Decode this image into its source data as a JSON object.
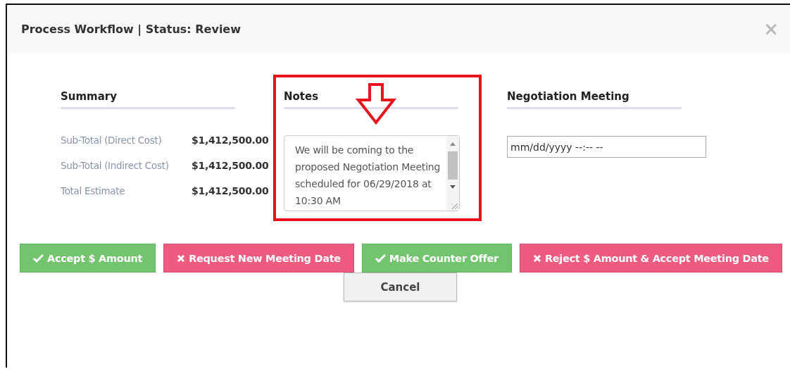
{
  "dialog": {
    "title": "Process Workflow | Status: Review",
    "close": "×"
  },
  "summary": {
    "heading": "Summary",
    "rows": [
      {
        "label": "Sub-Total (Direct Cost)",
        "value": "$1,412,500.00"
      },
      {
        "label": "Sub-Total (Indirect Cost)",
        "value": "$1,412,500.00"
      },
      {
        "label": "Total Estimate",
        "value": "$1,412,500.00"
      }
    ]
  },
  "notes": {
    "heading": "Notes",
    "value": "We will be coming to the proposed Negotiation Meeting scheduled for 06/29/2018 at 10:30 AM",
    "highlighted": true
  },
  "meeting": {
    "heading": "Negotiation Meeting",
    "placeholder": "mm/dd/yyyy --:-- --"
  },
  "actions": [
    {
      "label": "Accept $ Amount",
      "kind": "accept"
    },
    {
      "label": "Request New Meeting Date",
      "kind": "reject"
    },
    {
      "label": "Make Counter Offer",
      "kind": "accept"
    },
    {
      "label": "Reject $ Amount & Accept Meeting Date",
      "kind": "reject"
    }
  ],
  "cancel": "Cancel"
}
